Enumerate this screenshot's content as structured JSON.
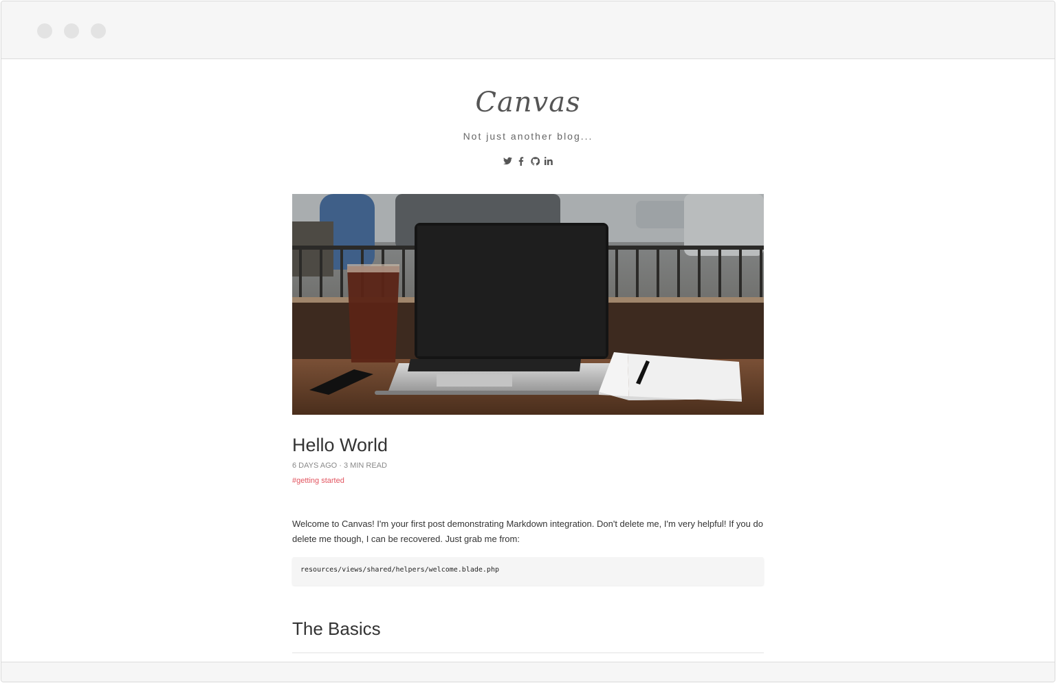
{
  "blog": {
    "logo": "Canvas",
    "tagline": "Not just another blog...",
    "social": [
      "twitter-icon",
      "facebook-icon",
      "github-icon",
      "linkedin-icon"
    ]
  },
  "post": {
    "title": "Hello World",
    "meta": "6 DAYS AGO · 3 MIN READ",
    "tag": "#getting started",
    "intro": "Welcome to Canvas! I'm your first post demonstrating Markdown integration. Don't delete me, I'm very helpful! If you do delete me though, I can be recovered. Just grab me from:",
    "code": "resources/views/shared/helpers/welcome.blade.php",
    "section_heading": "The Basics"
  },
  "colors": {
    "titlebar": "#f6f6f6",
    "tag": "#e2545f",
    "text": "#333333",
    "muted": "#888888"
  }
}
